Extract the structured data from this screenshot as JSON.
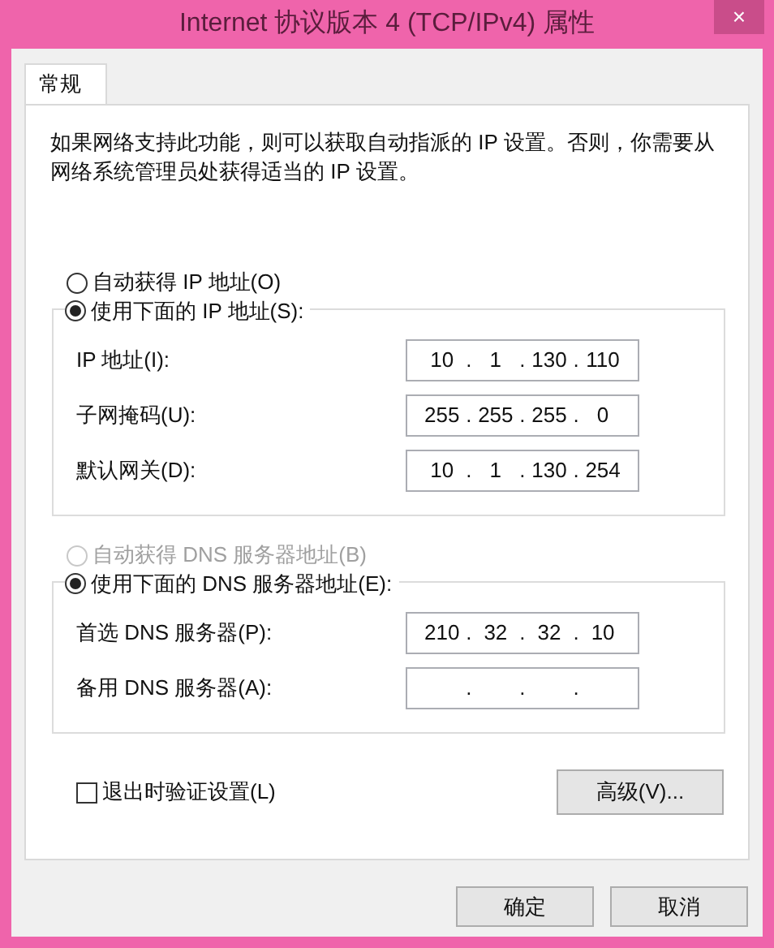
{
  "window": {
    "title": "Internet 协议版本 4 (TCP/IPv4) 属性",
    "close": "×"
  },
  "tabs": [
    {
      "label": "常规",
      "selected": true
    }
  ],
  "description": "如果网络支持此功能，则可以获取自动指派的 IP 设置。否则，你需要从网络系统管理员处获得适当的 IP 设置。",
  "ip_section": {
    "auto_option": {
      "label": "自动获得 IP 地址(O)",
      "selected": false,
      "disabled": false
    },
    "manual_option": {
      "label": "使用下面的 IP 地址(S):",
      "selected": true,
      "disabled": false
    },
    "fields": [
      {
        "label": "IP 地址(I):",
        "octets": [
          "10",
          "1",
          "130",
          "110"
        ],
        "separators": [
          ".",
          ".",
          "."
        ]
      },
      {
        "label": "子网掩码(U):",
        "octets": [
          "255",
          "255",
          "255",
          "0"
        ],
        "separators": [
          ".",
          ".",
          "."
        ]
      },
      {
        "label": "默认网关(D):",
        "octets": [
          "10",
          "1",
          "130",
          "254"
        ],
        "separators": [
          ".",
          ".",
          "."
        ]
      }
    ]
  },
  "dns_section": {
    "auto_option": {
      "label": "自动获得 DNS 服务器地址(B)",
      "selected": false,
      "disabled": true
    },
    "manual_option": {
      "label": "使用下面的 DNS 服务器地址(E):",
      "selected": true,
      "disabled": false
    },
    "fields": [
      {
        "label": "首选 DNS 服务器(P):",
        "octets": [
          "210",
          "32",
          "32",
          "10"
        ],
        "separators": [
          ".",
          ".",
          "."
        ]
      },
      {
        "label": "备用 DNS 服务器(A):",
        "separators": [
          ".",
          ".",
          "."
        ]
      }
    ]
  },
  "validate_checkbox": {
    "label": "退出时验证设置(L)",
    "checked": false
  },
  "advanced_button": "高级(V)...",
  "buttons": [
    "确定",
    "取消"
  ]
}
